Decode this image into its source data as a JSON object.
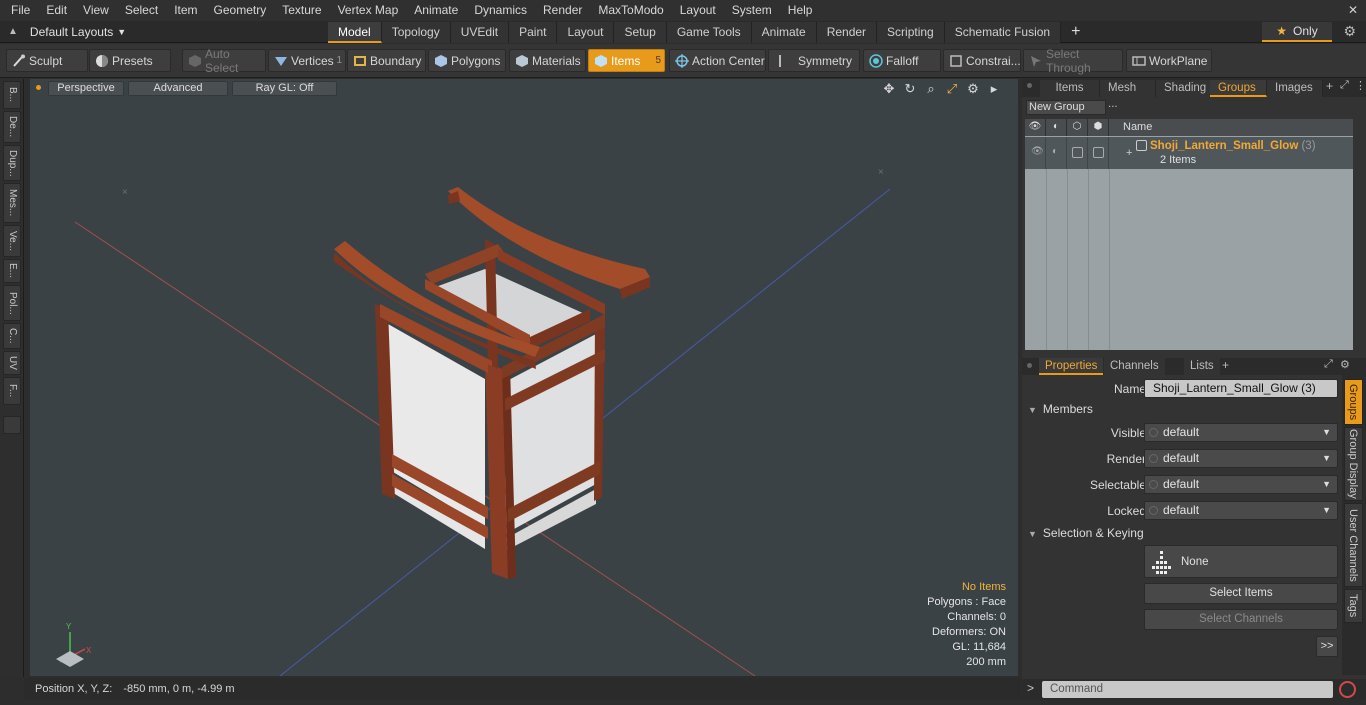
{
  "menu": [
    "File",
    "Edit",
    "View",
    "Select",
    "Item",
    "Geometry",
    "Texture",
    "Vertex Map",
    "Animate",
    "Dynamics",
    "Render",
    "MaxToModo",
    "Layout",
    "System",
    "Help"
  ],
  "layout_selector": "Default Layouts",
  "layout_tabs": [
    "Model",
    "Topology",
    "UVEdit",
    "Paint",
    "Layout",
    "Setup",
    "Game Tools",
    "Animate",
    "Render",
    "Scripting",
    "Schematic Fusion"
  ],
  "only_label": "Only",
  "toolbar": {
    "sculpt": "Sculpt",
    "presets": "Presets",
    "auto_select": "Auto Select",
    "vertices": "Vertices",
    "vertices_count": "1",
    "boundary": "Boundary",
    "polygons": "Polygons",
    "materials": "Materials",
    "items": "Items",
    "items_count": "5",
    "action_center": "Action Center",
    "symmetry": "Symmetry",
    "falloff": "Falloff",
    "constraints": "Constrai...",
    "select_through": "Select Through",
    "workplane": "WorkPlane"
  },
  "left_tabs": [
    "B...",
    "De...",
    "Dup...",
    "Mes...",
    "Ve...",
    "E...",
    "Pol...",
    "C...",
    "UV",
    "F..."
  ],
  "viewport": {
    "view": "Perspective",
    "shading": "Advanced",
    "raygl": "Ray GL: Off",
    "info": {
      "selection": "No Items",
      "polygons": "Polygons : Face",
      "channels": "Channels: 0",
      "deformers": "Deformers: ON",
      "gl": "GL: 11,684",
      "scale": "200 mm"
    }
  },
  "status": {
    "label": "Position X, Y, Z:",
    "value": "-850 mm, 0 m, -4.99 m"
  },
  "groups_panel": {
    "tabs": [
      "Items",
      "Mesh ...",
      "Shading",
      "Groups",
      "Images"
    ],
    "active_tab": "Groups",
    "new_group": "New Group",
    "name_header": "Name",
    "group_name": "Shoji_Lantern_Small_Glow",
    "group_count": "(3)",
    "group_items": "2 Items"
  },
  "properties": {
    "tabs": [
      "Properties",
      "Channels",
      "Lists"
    ],
    "name_label": "Name",
    "name_value": "Shoji_Lantern_Small_Glow (3)",
    "members_section": "Members",
    "visible_label": "Visible",
    "visible_value": "default",
    "render_label": "Render",
    "render_value": "default",
    "selectable_label": "Selectable",
    "selectable_value": "default",
    "locked_label": "Locked",
    "locked_value": "default",
    "selection_section": "Selection & Keying",
    "none_label": "None",
    "select_items": "Select Items",
    "select_channels": "Select Channels",
    "more": ">>",
    "side_tabs": [
      "Groups",
      "Group Display",
      "User Channels",
      "Tags"
    ]
  },
  "command_placeholder": "Command"
}
